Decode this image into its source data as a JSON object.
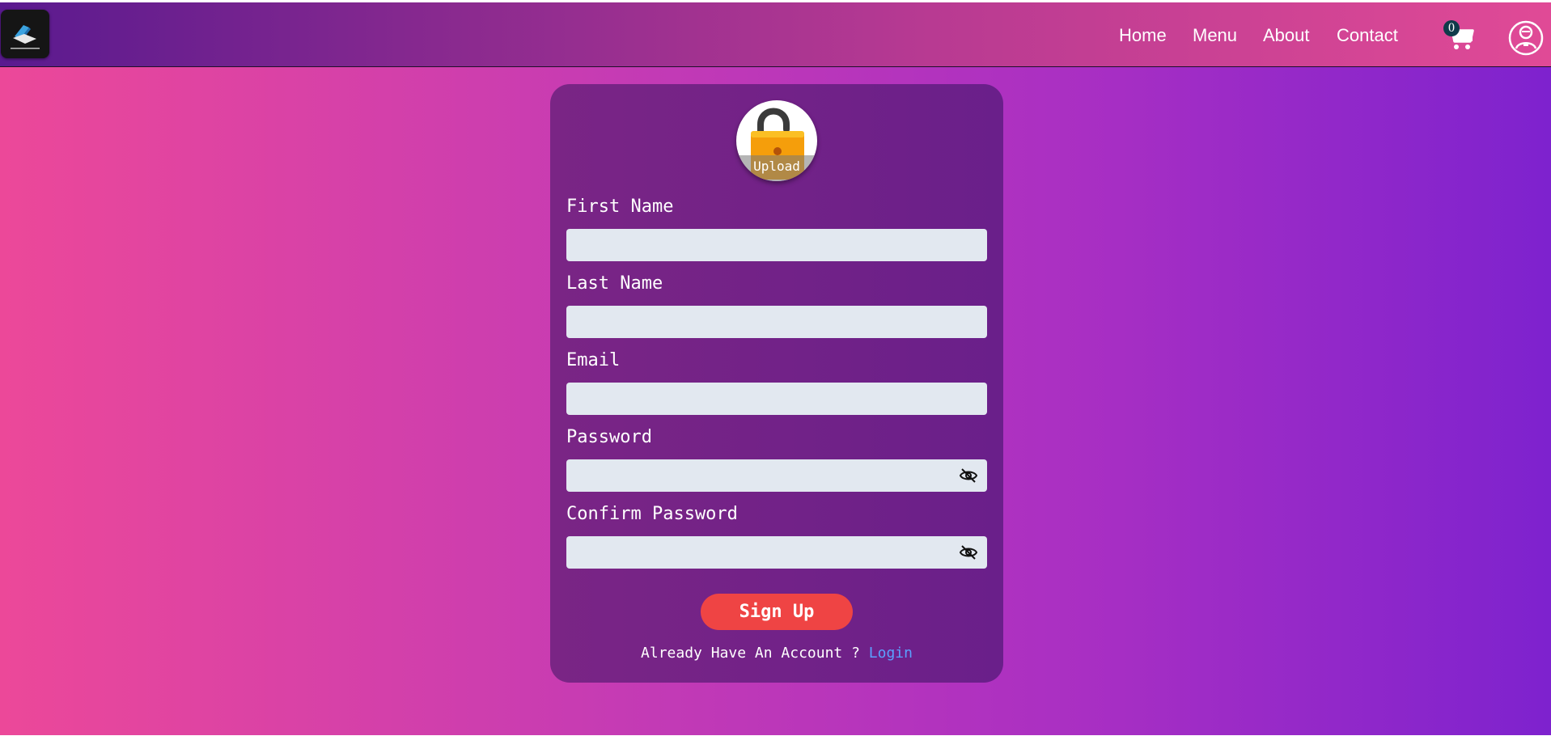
{
  "header": {
    "logo_icon": "laptop-logo-icon",
    "nav": {
      "home": "Home",
      "menu": "Menu",
      "about": "About",
      "contact": "Contact"
    },
    "cart_count": "0",
    "cart_icon": "cart-icon",
    "user_icon": "user-avatar-icon"
  },
  "form": {
    "avatar_icon": "padlock-icon",
    "upload_label": "Upload",
    "first_name_label": "First Name",
    "first_name_value": "",
    "last_name_label": "Last Name",
    "last_name_value": "",
    "email_label": "Email",
    "email_value": "",
    "password_label": "Password",
    "password_value": "",
    "confirm_password_label": "Confirm Password",
    "confirm_password_value": "",
    "password_toggle_icon": "eye-off-icon",
    "submit_label": "Sign Up",
    "footer_prompt": "Already Have An Account ? ",
    "login_link": "Login"
  },
  "colors": {
    "submit_button": "#ef4444",
    "login_link": "#5aa0ff",
    "input_bg": "#e2e8f0",
    "card_bg": "#74218a",
    "badge_bg": "#0f3b4a"
  }
}
